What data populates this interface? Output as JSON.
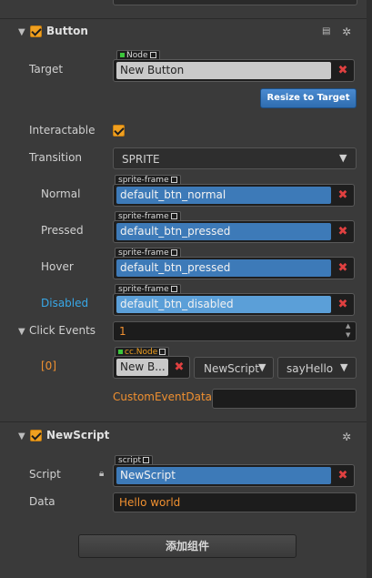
{
  "button_section": {
    "title": "Button",
    "target_label": "Target",
    "target_tag": "Node",
    "target_value": "New Button",
    "resize_label": "Resize to Target",
    "interactable_label": "Interactable",
    "transition_label": "Transition",
    "transition_value": "SPRITE",
    "sprites": [
      {
        "label": "Normal",
        "tag": "sprite-frame",
        "value": "default_btn_normal"
      },
      {
        "label": "Pressed",
        "tag": "sprite-frame",
        "value": "default_btn_pressed"
      },
      {
        "label": "Hover",
        "tag": "sprite-frame",
        "value": "default_btn_pressed"
      },
      {
        "label": "Disabled",
        "tag": "sprite-frame",
        "value": "default_btn_disabled"
      }
    ],
    "click_events_label": "Click Events",
    "click_events_count": "1",
    "event_index": "[0]",
    "event_node_tag": "cc.Node",
    "event_node_value": "New B...",
    "event_component": "NewScript",
    "event_handler": "sayHello",
    "custom_event_label": "CustomEventData",
    "custom_event_value": ""
  },
  "script_section": {
    "title": "NewScript",
    "script_label": "Script",
    "script_tag": "script",
    "script_value": "NewScript",
    "data_label": "Data",
    "data_value": "Hello world"
  },
  "add_component_label": "添加组件",
  "colors": {
    "accent_orange": "#f0a020",
    "field_blue": "#3d7ab8",
    "disabled_cyan": "#38a8e8",
    "remove_red": "#e04040"
  }
}
